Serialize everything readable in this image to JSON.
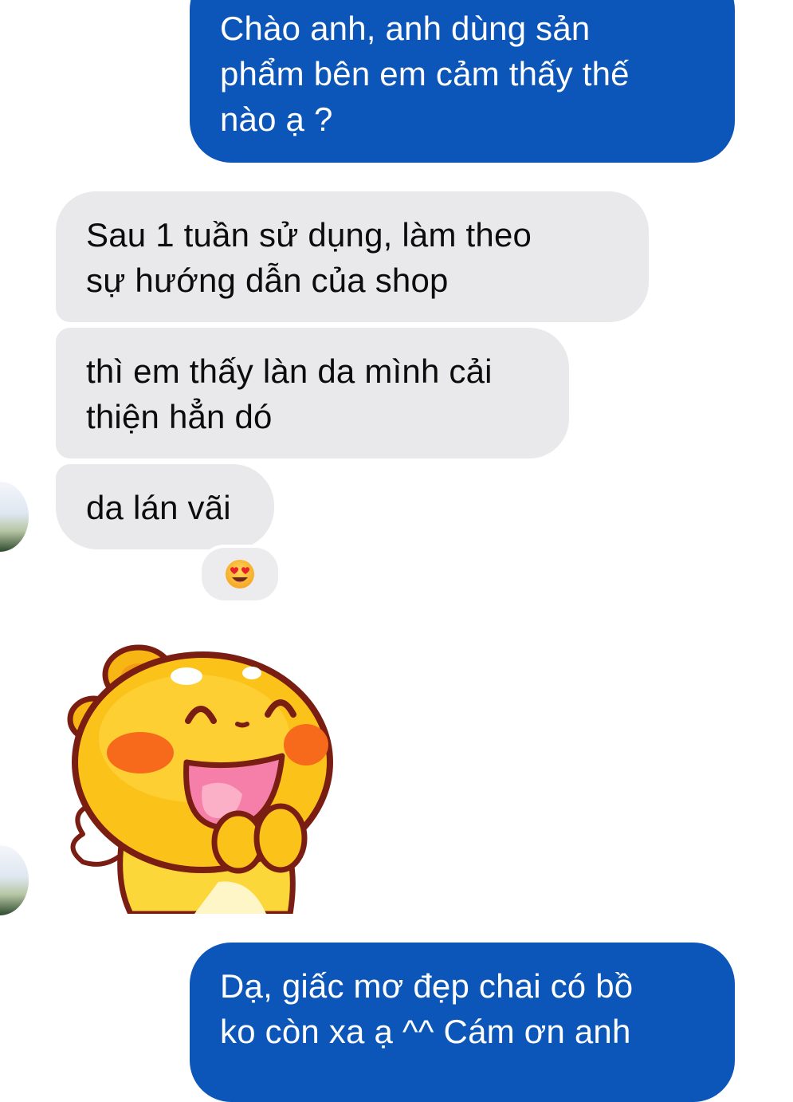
{
  "messages": {
    "outgoing_1": {
      "line1": "Chào anh, anh dùng sản",
      "line2": "phẩm bên em cảm thấy thế",
      "line3": "nào ạ ?"
    },
    "incoming_1": {
      "line1": "Sau 1 tuần sử dụng, làm theo",
      "line2": "sự hướng dẫn của shop"
    },
    "incoming_2": {
      "line1": "thì em thấy làn da mình cải",
      "line2": "thiện hẳn dó"
    },
    "incoming_3": {
      "line1": "da lán vãi"
    },
    "reaction": {
      "icon": "heart-eyes-emoji"
    },
    "sticker": {
      "icon": "happy-yellow-bear-sticker"
    },
    "outgoing_2": {
      "line1": "Dạ, giấc mơ đẹp chai có bồ",
      "line2": "ko còn xa ạ ^^ Cám ơn anh"
    }
  },
  "colors": {
    "outgoing_bubble": "#0b56b8",
    "incoming_bubble": "#e9e9eb",
    "outgoing_text": "#ffffff",
    "incoming_text": "#0c0c0c"
  }
}
